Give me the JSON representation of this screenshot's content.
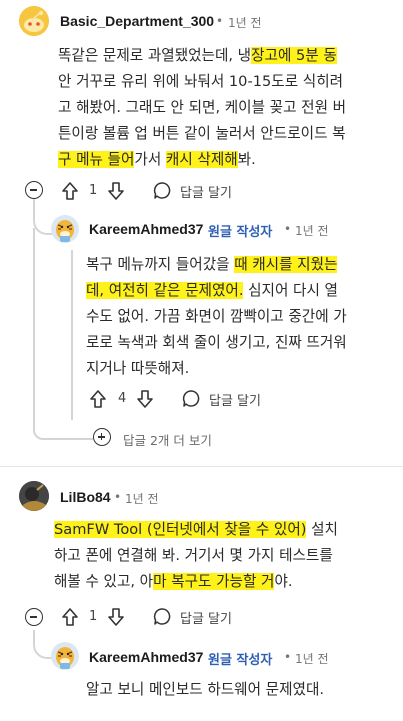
{
  "comments": [
    {
      "username": "Basic_Department_300",
      "time": "1년 전",
      "lines": [
        [
          {
            "t": "똑같은 문제로 과열됐었는데, 냉"
          },
          {
            "t": "장고에 5분 동",
            "hl": true
          }
        ],
        [
          {
            "t": "안 거꾸로 유리 위에 놔둬서 10-15도로 식히려"
          }
        ],
        [
          {
            "t": "고 해봤어. 그래도 안 되면, 케이블 꽂고 전원 버"
          }
        ],
        [
          {
            "t": "튼이랑 볼륨 업 버튼 같이 눌러서 안드로이드 복"
          }
        ],
        [
          {
            "t": "구 메뉴 들어",
            "hl": true
          },
          {
            "t": "가서 "
          },
          {
            "t": "캐시 삭제해",
            "hl": true
          },
          {
            "t": "봐."
          }
        ]
      ],
      "votes": "1",
      "reply_label": "답글 달기"
    },
    {
      "username": "KareemAhmed37",
      "op_label": "원글 작성자",
      "time": "1년 전",
      "lines": [
        [
          {
            "t": "복구 메뉴까지 들어갔을 "
          },
          {
            "t": "때 캐시를 지웠는",
            "hl": true
          }
        ],
        [
          {
            "t": "데, 여전히 같은 문제였어.",
            "hl": true
          },
          {
            "t": " 심지어 다시 열"
          }
        ],
        [
          {
            "t": "수도 없어. 가끔 화면이 깜빡이고 중간에 가"
          }
        ],
        [
          {
            "t": "로로 녹색과 회색 줄이 생기고, 진짜 뜨거워"
          }
        ],
        [
          {
            "t": "지거나 따뜻해져."
          }
        ]
      ],
      "votes": "4",
      "reply_label": "답글 달기",
      "more_replies": "답글 2개 더 보기"
    },
    {
      "username": "LilBo84",
      "time": "1년 전",
      "lines": [
        [
          {
            "t": "SamFW Tool (인터넷에서 찾을 수 있어)",
            "hl": true
          },
          {
            "t": " 설치"
          }
        ],
        [
          {
            "t": "하고 폰에 연결해 봐. 거기서 몇 가지 테스트를"
          }
        ],
        [
          {
            "t": "해볼 수 있고, 아"
          },
          {
            "t": "마 복구도 가능할 거",
            "hl": true
          },
          {
            "t": "야."
          }
        ]
      ],
      "votes": "1",
      "reply_label": "답글 달기"
    },
    {
      "username": "KareemAhmed37",
      "op_label": "원글 작성자",
      "time": "1년 전",
      "lines": [
        [
          {
            "t": "알고 보니 메인보드 하드웨어 문제였대."
          }
        ]
      ]
    }
  ]
}
